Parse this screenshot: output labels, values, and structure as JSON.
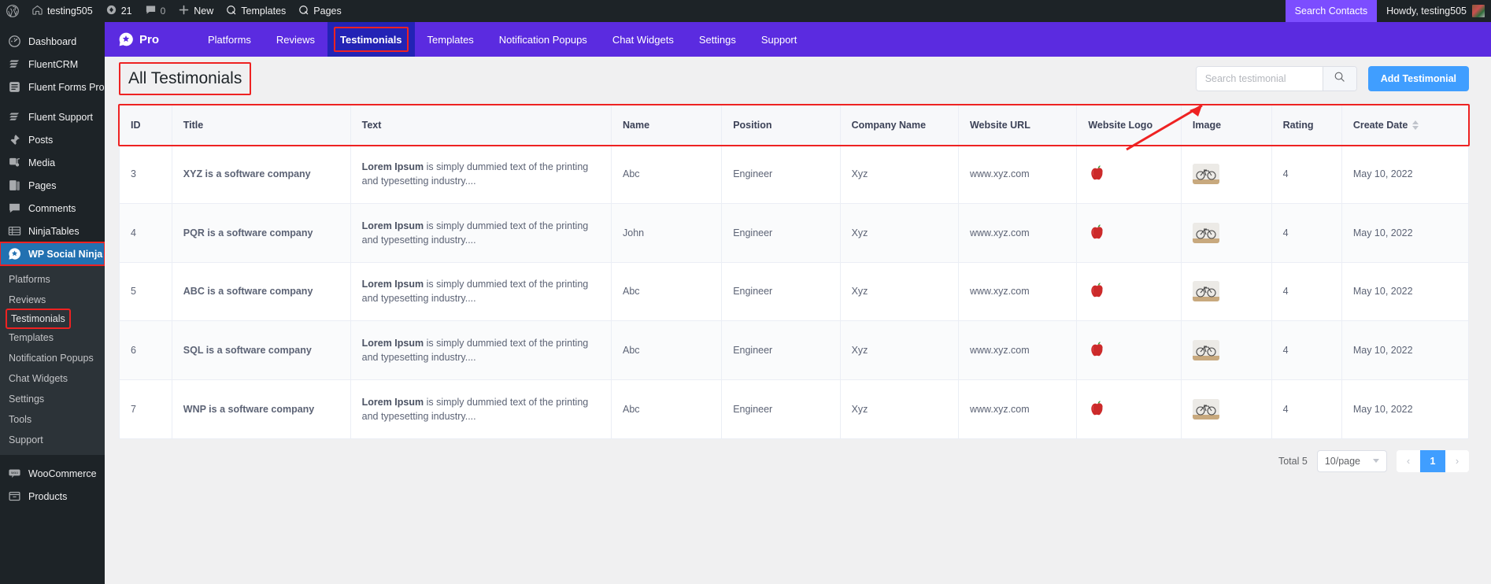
{
  "adminbar": {
    "wp_logo": "wordpress-logo-icon",
    "site_name": "testing505",
    "updates_count": "21",
    "comments_count": "0",
    "new_label": "New",
    "templates_label": "Templates",
    "pages_label": "Pages",
    "search_contacts": "Search Contacts",
    "howdy": "Howdy, testing505"
  },
  "sidebar": {
    "items": [
      {
        "label": "Dashboard",
        "icon": "dashboard-icon"
      },
      {
        "label": "FluentCRM",
        "icon": "fluentcrm-icon"
      },
      {
        "label": "Fluent Forms Pro",
        "icon": "fluent-forms-icon"
      },
      {
        "label": "Fluent Support",
        "icon": "fluent-support-icon"
      },
      {
        "label": "Posts",
        "icon": "pin-icon"
      },
      {
        "label": "Media",
        "icon": "media-icon"
      },
      {
        "label": "Pages",
        "icon": "pages-icon"
      },
      {
        "label": "Comments",
        "icon": "comment-icon"
      },
      {
        "label": "NinjaTables",
        "icon": "table-icon"
      }
    ],
    "active_item": {
      "label": "WP Social Ninja",
      "icon": "wp-social-ninja-icon"
    },
    "submenu": [
      {
        "label": "Platforms",
        "highlighted": false
      },
      {
        "label": "Reviews",
        "highlighted": false
      },
      {
        "label": "Testimonials",
        "highlighted": true
      },
      {
        "label": "Templates",
        "highlighted": false
      },
      {
        "label": "Notification Popups",
        "highlighted": false
      },
      {
        "label": "Chat Widgets",
        "highlighted": false
      },
      {
        "label": "Settings",
        "highlighted": false
      },
      {
        "label": "Tools",
        "highlighted": false
      },
      {
        "label": "Support",
        "highlighted": false
      }
    ],
    "bottom_items": [
      {
        "label": "WooCommerce",
        "icon": "woocommerce-icon"
      },
      {
        "label": "Products",
        "icon": "products-icon"
      }
    ]
  },
  "nav": {
    "brand": "Pro",
    "brand_icon": "wp-social-ninja-badge-icon",
    "tabs": [
      {
        "label": "Platforms",
        "active": false
      },
      {
        "label": "Reviews",
        "active": false
      },
      {
        "label": "Testimonials",
        "active": true
      },
      {
        "label": "Templates",
        "active": false
      },
      {
        "label": "Notification Popups",
        "active": false
      },
      {
        "label": "Chat Widgets",
        "active": false
      },
      {
        "label": "Settings",
        "active": false
      },
      {
        "label": "Support",
        "active": false
      }
    ],
    "accent_bg": "#5b2be0",
    "active_bg": "#2323b5"
  },
  "header": {
    "title": "All Testimonials",
    "search_placeholder": "Search testimonial",
    "search_value": "",
    "search_icon": "search-icon",
    "add_button": "Add Testimonial",
    "add_button_color": "#409eff"
  },
  "table": {
    "columns": [
      {
        "label": "ID",
        "sortable": false
      },
      {
        "label": "Title",
        "sortable": false
      },
      {
        "label": "Text",
        "sortable": false
      },
      {
        "label": "Name",
        "sortable": false
      },
      {
        "label": "Position",
        "sortable": false
      },
      {
        "label": "Company Name",
        "sortable": false
      },
      {
        "label": "Website URL",
        "sortable": false
      },
      {
        "label": "Website Logo",
        "sortable": false
      },
      {
        "label": "Image",
        "sortable": false
      },
      {
        "label": "Rating",
        "sortable": false
      },
      {
        "label": "Create Date",
        "sortable": true
      }
    ],
    "rows": [
      {
        "id": "3",
        "title": "XYZ is a software company",
        "text_bold": "Lorem Ipsum",
        "text_rest": " is simply dummied text of the printing and typesetting industry....",
        "name": "Abc",
        "position": "Engineer",
        "company": "Xyz",
        "url": "www.xyz.com",
        "logo": "apple-thumbnail",
        "image": "bicycle-thumbnail",
        "rating": "4",
        "date": "May 10, 2022"
      },
      {
        "id": "4",
        "title": "PQR is a software company",
        "text_bold": "Lorem Ipsum",
        "text_rest": " is simply dummied text of the printing and typesetting industry....",
        "name": "John",
        "position": "Engineer",
        "company": "Xyz",
        "url": "www.xyz.com",
        "logo": "apple-thumbnail",
        "image": "bicycle-thumbnail",
        "rating": "4",
        "date": "May 10, 2022"
      },
      {
        "id": "5",
        "title": "ABC is a software company",
        "text_bold": "Lorem Ipsum",
        "text_rest": " is simply dummied text of the printing and typesetting industry....",
        "name": "Abc",
        "position": "Engineer",
        "company": "Xyz",
        "url": "www.xyz.com",
        "logo": "apple-thumbnail",
        "image": "bicycle-thumbnail",
        "rating": "4",
        "date": "May 10, 2022"
      },
      {
        "id": "6",
        "title": "SQL is a software company",
        "text_bold": "Lorem Ipsum",
        "text_rest": " is simply dummied text of the printing and typesetting industry....",
        "name": "Abc",
        "position": "Engineer",
        "company": "Xyz",
        "url": "www.xyz.com",
        "logo": "apple-thumbnail",
        "image": "bicycle-thumbnail",
        "rating": "4",
        "date": "May 10, 2022"
      },
      {
        "id": "7",
        "title": "WNP is a software company",
        "text_bold": "Lorem Ipsum",
        "text_rest": " is simply dummied text of the printing and typesetting industry....",
        "name": "Abc",
        "position": "Engineer",
        "company": "Xyz",
        "url": "www.xyz.com",
        "logo": "apple-thumbnail",
        "image": "bicycle-thumbnail",
        "rating": "4",
        "date": "May 10, 2022"
      }
    ]
  },
  "footer": {
    "total": "Total 5",
    "per_page": "10/page",
    "prev": "‹",
    "next": "›",
    "current_page": "1"
  }
}
